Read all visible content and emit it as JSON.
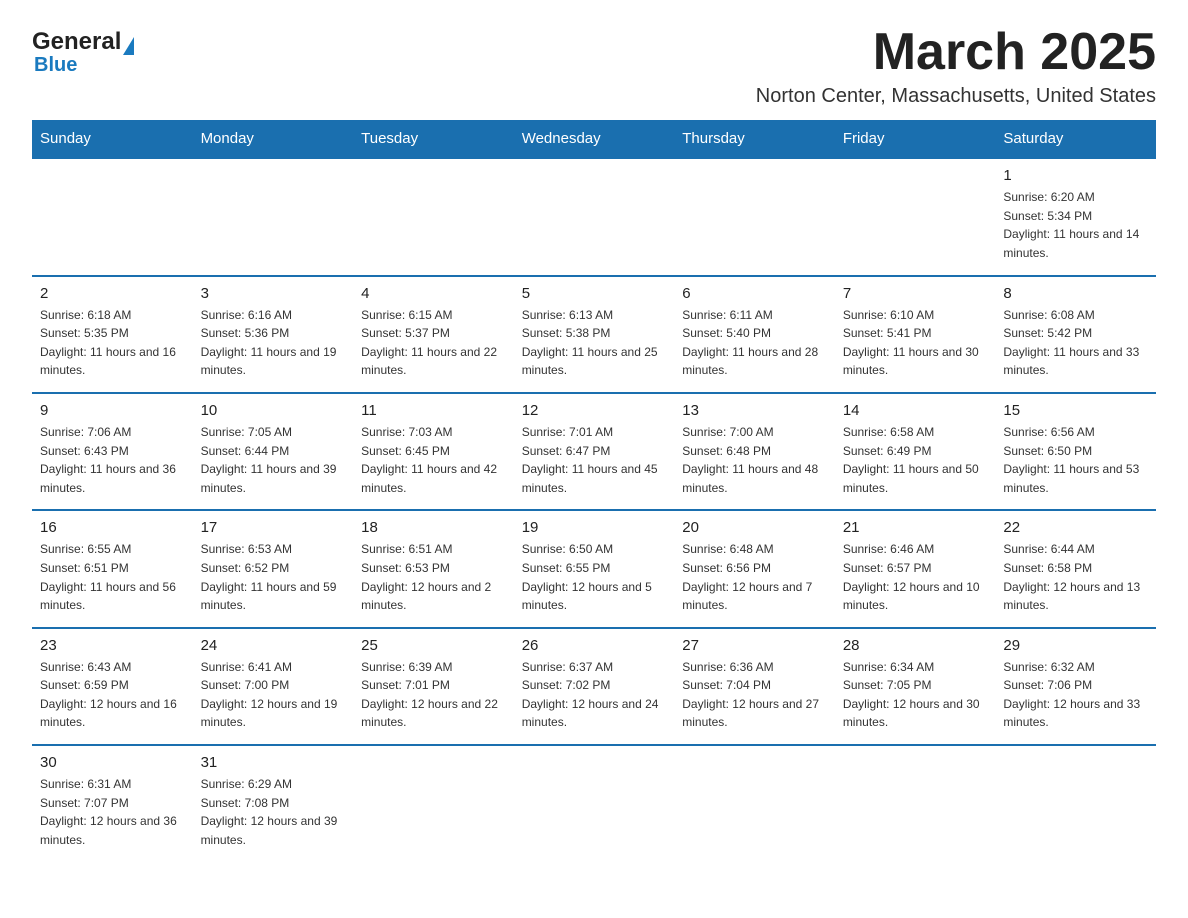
{
  "header": {
    "logo_general": "General",
    "logo_blue": "Blue",
    "title": "March 2025",
    "subtitle": "Norton Center, Massachusetts, United States"
  },
  "days_of_week": [
    "Sunday",
    "Monday",
    "Tuesday",
    "Wednesday",
    "Thursday",
    "Friday",
    "Saturday"
  ],
  "weeks": [
    [
      {
        "day": "",
        "info": ""
      },
      {
        "day": "",
        "info": ""
      },
      {
        "day": "",
        "info": ""
      },
      {
        "day": "",
        "info": ""
      },
      {
        "day": "",
        "info": ""
      },
      {
        "day": "",
        "info": ""
      },
      {
        "day": "1",
        "info": "Sunrise: 6:20 AM\nSunset: 5:34 PM\nDaylight: 11 hours and 14 minutes."
      }
    ],
    [
      {
        "day": "2",
        "info": "Sunrise: 6:18 AM\nSunset: 5:35 PM\nDaylight: 11 hours and 16 minutes."
      },
      {
        "day": "3",
        "info": "Sunrise: 6:16 AM\nSunset: 5:36 PM\nDaylight: 11 hours and 19 minutes."
      },
      {
        "day": "4",
        "info": "Sunrise: 6:15 AM\nSunset: 5:37 PM\nDaylight: 11 hours and 22 minutes."
      },
      {
        "day": "5",
        "info": "Sunrise: 6:13 AM\nSunset: 5:38 PM\nDaylight: 11 hours and 25 minutes."
      },
      {
        "day": "6",
        "info": "Sunrise: 6:11 AM\nSunset: 5:40 PM\nDaylight: 11 hours and 28 minutes."
      },
      {
        "day": "7",
        "info": "Sunrise: 6:10 AM\nSunset: 5:41 PM\nDaylight: 11 hours and 30 minutes."
      },
      {
        "day": "8",
        "info": "Sunrise: 6:08 AM\nSunset: 5:42 PM\nDaylight: 11 hours and 33 minutes."
      }
    ],
    [
      {
        "day": "9",
        "info": "Sunrise: 7:06 AM\nSunset: 6:43 PM\nDaylight: 11 hours and 36 minutes."
      },
      {
        "day": "10",
        "info": "Sunrise: 7:05 AM\nSunset: 6:44 PM\nDaylight: 11 hours and 39 minutes."
      },
      {
        "day": "11",
        "info": "Sunrise: 7:03 AM\nSunset: 6:45 PM\nDaylight: 11 hours and 42 minutes."
      },
      {
        "day": "12",
        "info": "Sunrise: 7:01 AM\nSunset: 6:47 PM\nDaylight: 11 hours and 45 minutes."
      },
      {
        "day": "13",
        "info": "Sunrise: 7:00 AM\nSunset: 6:48 PM\nDaylight: 11 hours and 48 minutes."
      },
      {
        "day": "14",
        "info": "Sunrise: 6:58 AM\nSunset: 6:49 PM\nDaylight: 11 hours and 50 minutes."
      },
      {
        "day": "15",
        "info": "Sunrise: 6:56 AM\nSunset: 6:50 PM\nDaylight: 11 hours and 53 minutes."
      }
    ],
    [
      {
        "day": "16",
        "info": "Sunrise: 6:55 AM\nSunset: 6:51 PM\nDaylight: 11 hours and 56 minutes."
      },
      {
        "day": "17",
        "info": "Sunrise: 6:53 AM\nSunset: 6:52 PM\nDaylight: 11 hours and 59 minutes."
      },
      {
        "day": "18",
        "info": "Sunrise: 6:51 AM\nSunset: 6:53 PM\nDaylight: 12 hours and 2 minutes."
      },
      {
        "day": "19",
        "info": "Sunrise: 6:50 AM\nSunset: 6:55 PM\nDaylight: 12 hours and 5 minutes."
      },
      {
        "day": "20",
        "info": "Sunrise: 6:48 AM\nSunset: 6:56 PM\nDaylight: 12 hours and 7 minutes."
      },
      {
        "day": "21",
        "info": "Sunrise: 6:46 AM\nSunset: 6:57 PM\nDaylight: 12 hours and 10 minutes."
      },
      {
        "day": "22",
        "info": "Sunrise: 6:44 AM\nSunset: 6:58 PM\nDaylight: 12 hours and 13 minutes."
      }
    ],
    [
      {
        "day": "23",
        "info": "Sunrise: 6:43 AM\nSunset: 6:59 PM\nDaylight: 12 hours and 16 minutes."
      },
      {
        "day": "24",
        "info": "Sunrise: 6:41 AM\nSunset: 7:00 PM\nDaylight: 12 hours and 19 minutes."
      },
      {
        "day": "25",
        "info": "Sunrise: 6:39 AM\nSunset: 7:01 PM\nDaylight: 12 hours and 22 minutes."
      },
      {
        "day": "26",
        "info": "Sunrise: 6:37 AM\nSunset: 7:02 PM\nDaylight: 12 hours and 24 minutes."
      },
      {
        "day": "27",
        "info": "Sunrise: 6:36 AM\nSunset: 7:04 PM\nDaylight: 12 hours and 27 minutes."
      },
      {
        "day": "28",
        "info": "Sunrise: 6:34 AM\nSunset: 7:05 PM\nDaylight: 12 hours and 30 minutes."
      },
      {
        "day": "29",
        "info": "Sunrise: 6:32 AM\nSunset: 7:06 PM\nDaylight: 12 hours and 33 minutes."
      }
    ],
    [
      {
        "day": "30",
        "info": "Sunrise: 6:31 AM\nSunset: 7:07 PM\nDaylight: 12 hours and 36 minutes."
      },
      {
        "day": "31",
        "info": "Sunrise: 6:29 AM\nSunset: 7:08 PM\nDaylight: 12 hours and 39 minutes."
      },
      {
        "day": "",
        "info": ""
      },
      {
        "day": "",
        "info": ""
      },
      {
        "day": "",
        "info": ""
      },
      {
        "day": "",
        "info": ""
      },
      {
        "day": "",
        "info": ""
      }
    ]
  ]
}
